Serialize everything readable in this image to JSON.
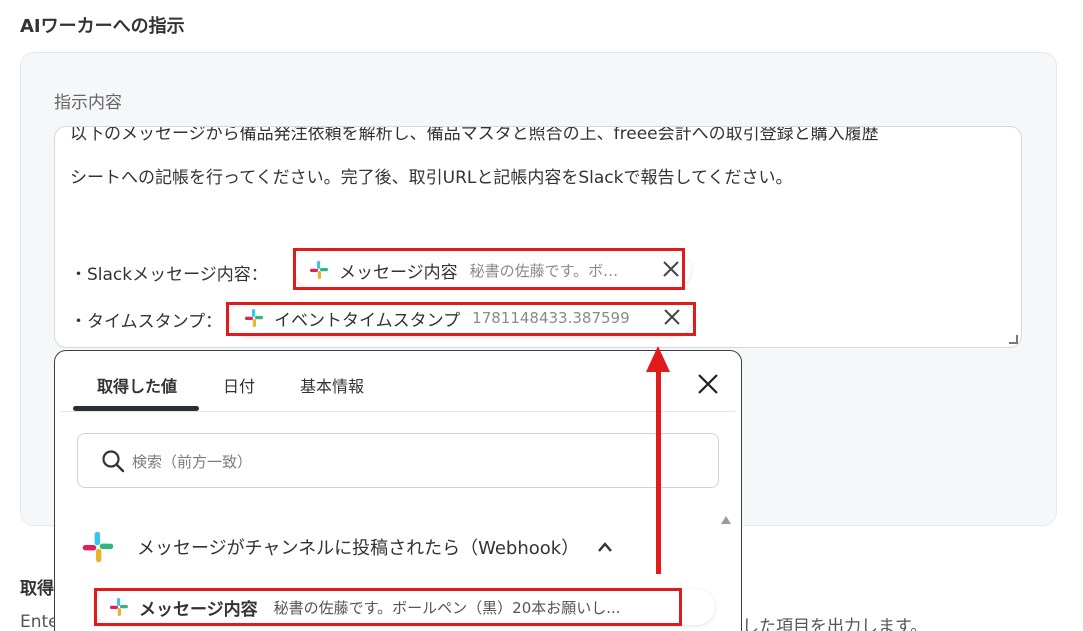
{
  "section": {
    "title": "AIワーカーへの指示"
  },
  "field": {
    "label": "指示内容"
  },
  "editor": {
    "line1": "以下のメッセージから備品発注依頼を解析し、備品マスタと照合の上、freee会計への取引登録と購入履歴",
    "line2": "シートへの記帳を行ってください。完了後、取引URLと記帳内容をSlackで報告してください。",
    "slack_label": "・Slackメッセージ内容：",
    "timestamp_label": "・タイムスタンプ："
  },
  "chips": [
    {
      "name": "メッセージ内容",
      "value": "秘書の佐藤です。ボ…",
      "icon": "slack-icon"
    },
    {
      "name": "イベントタイムスタンプ",
      "value": "1781148433.387599",
      "icon": "slack-icon"
    }
  ],
  "popup": {
    "tabs": [
      {
        "label": "取得した値"
      },
      {
        "label": "日付"
      },
      {
        "label": "基本情報"
      }
    ],
    "search_placeholder": "検索（前方一致）",
    "group_title": "メッセージがチャンネルに投稿されたら（Webhook）",
    "item": {
      "name": "メッセージ内容",
      "value": "秘書の佐藤です。ボールペン（黒）20本お願いし..."
    }
  },
  "background": {
    "heading_fragment": "取得",
    "text_left_fragment": "Ente",
    "text_right_fragment": "した項目を出力します。"
  },
  "colors": {
    "highlight": "#e01b1b",
    "slack_blue": "#36C5F0",
    "slack_green": "#2EB67D",
    "slack_yellow": "#ECB22E",
    "slack_red": "#E01E5A"
  }
}
